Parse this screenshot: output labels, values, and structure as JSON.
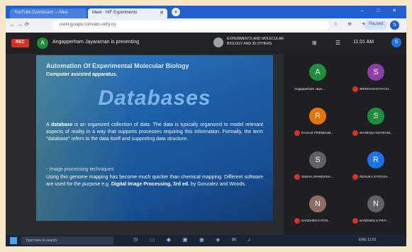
{
  "browser": {
    "tabs": [
      {
        "label": "YouTube Dashboard — Mee"
      },
      {
        "label": "Meet - HIF Experiments"
      }
    ],
    "new_tab": "+",
    "window_controls": "– □ ✕",
    "nav_icons": "← → ⟳",
    "url": "meet.google.com/abc-defg-hij",
    "toolbar_icons": "☆ ⊕ ✦",
    "paused_label": "Paused",
    "profile_initial": "S"
  },
  "meet": {
    "rec_label": "REC",
    "presenter_initial": "A",
    "presenting_text": "Angapperham Jayaraman is presenting",
    "call_info": "EXPERIMENTS AND MOLECULAR BIOLOGY AND 35 OTHERS",
    "controls_icons": "⊞ ☰",
    "clock": "11:01 AM",
    "user_initial": "S"
  },
  "slide": {
    "heading": "Automation Of Experimental Molecular Biology",
    "subheading": "Computer assisted apparatus.",
    "title": "Databases",
    "body_lead": "A ",
    "body_term": "database",
    "body_rest": " is an organized collection of data. The data is typically organized to model relevant aspects of reality in a way that supports processes requiring this information. Formally, the term \"database\" refers to the data itself and supporting data structure.",
    "section": "- Image processing techniques",
    "body2_lead": "Using this genome mapping has become much quicker than chemical mapping. Different software are used for the purpose e.g. ",
    "body2_ref": "Digital Image Processing, 3rd ed.",
    "body2_tail": " by Gonzalez and Woods."
  },
  "participants": [
    {
      "initial": "A",
      "name": "Angapperham Jaya...",
      "color": "#1e8e3e",
      "muted": false
    },
    {
      "initial": "S",
      "name": "SRINIVASAN RAGH...",
      "color": "#8e3ea8",
      "muted": true
    },
    {
      "initial": "R",
      "name": "RAJALE PREMKUM...",
      "color": "#e37400",
      "muted": true
    },
    {
      "initial": "S",
      "name": "SHABANA NOORANI...",
      "color": "#1e8e3e",
      "muted": true
    },
    {
      "initial": "S",
      "name": "SNEHA SPANDANA...",
      "color": "#5f6368",
      "muted": true
    },
    {
      "initial": "R",
      "name": "RENUKA S POOJA...",
      "color": "#1a73e8",
      "muted": true
    },
    {
      "initial": "N",
      "name": "NANDHINI K POO...",
      "color": "#8d6e63",
      "muted": true
    },
    {
      "initial": "N",
      "name": "NANDHINI S PRIY...",
      "color": "#5f6368",
      "muted": true
    }
  ],
  "taskbar": {
    "search_placeholder": "Type here to search",
    "pinned_icons": "⊙ ▭ ◆ ▣ ◉ ◈ ✉ ♪",
    "tray": "ENG  11:01"
  }
}
